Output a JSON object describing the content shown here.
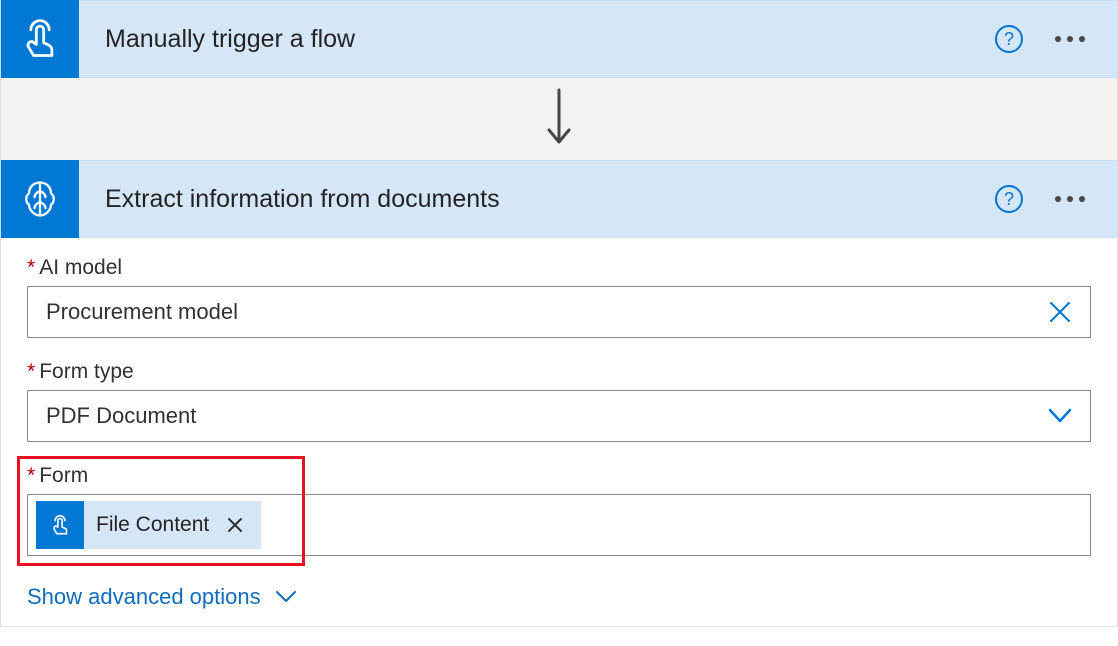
{
  "trigger": {
    "title": "Manually trigger a flow"
  },
  "action": {
    "title": "Extract information from documents",
    "fields": {
      "ai_model": {
        "label": "AI model",
        "value": "Procurement model"
      },
      "form_type": {
        "label": "Form type",
        "value": "PDF Document"
      },
      "form": {
        "label": "Form",
        "token": "File Content"
      }
    },
    "advanced_link": "Show advanced options"
  }
}
